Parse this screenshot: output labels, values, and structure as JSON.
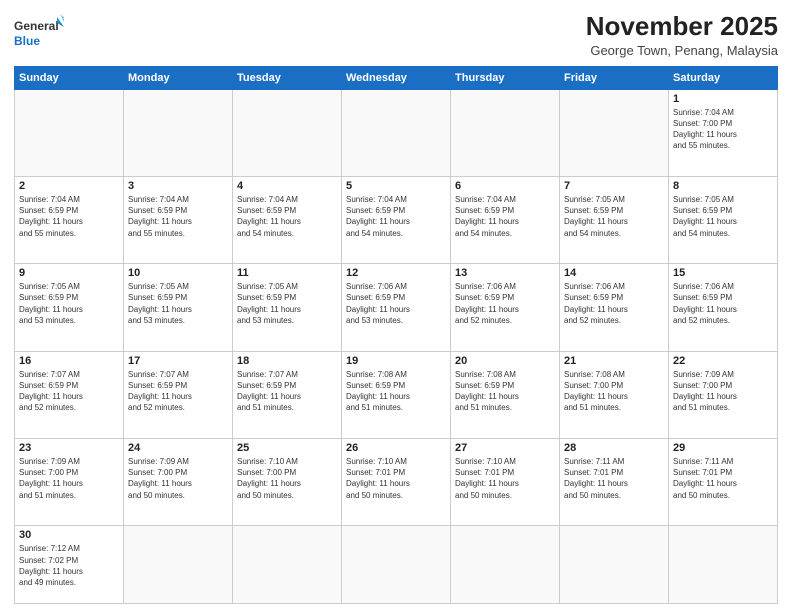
{
  "header": {
    "logo_general": "General",
    "logo_blue": "Blue",
    "month_year": "November 2025",
    "location": "George Town, Penang, Malaysia"
  },
  "days_of_week": [
    "Sunday",
    "Monday",
    "Tuesday",
    "Wednesday",
    "Thursday",
    "Friday",
    "Saturday"
  ],
  "weeks": [
    [
      {
        "day": "",
        "info": ""
      },
      {
        "day": "",
        "info": ""
      },
      {
        "day": "",
        "info": ""
      },
      {
        "day": "",
        "info": ""
      },
      {
        "day": "",
        "info": ""
      },
      {
        "day": "",
        "info": ""
      },
      {
        "day": "1",
        "info": "Sunrise: 7:04 AM\nSunset: 7:00 PM\nDaylight: 11 hours\nand 55 minutes."
      }
    ],
    [
      {
        "day": "2",
        "info": "Sunrise: 7:04 AM\nSunset: 6:59 PM\nDaylight: 11 hours\nand 55 minutes."
      },
      {
        "day": "3",
        "info": "Sunrise: 7:04 AM\nSunset: 6:59 PM\nDaylight: 11 hours\nand 55 minutes."
      },
      {
        "day": "4",
        "info": "Sunrise: 7:04 AM\nSunset: 6:59 PM\nDaylight: 11 hours\nand 54 minutes."
      },
      {
        "day": "5",
        "info": "Sunrise: 7:04 AM\nSunset: 6:59 PM\nDaylight: 11 hours\nand 54 minutes."
      },
      {
        "day": "6",
        "info": "Sunrise: 7:04 AM\nSunset: 6:59 PM\nDaylight: 11 hours\nand 54 minutes."
      },
      {
        "day": "7",
        "info": "Sunrise: 7:05 AM\nSunset: 6:59 PM\nDaylight: 11 hours\nand 54 minutes."
      },
      {
        "day": "8",
        "info": "Sunrise: 7:05 AM\nSunset: 6:59 PM\nDaylight: 11 hours\nand 54 minutes."
      }
    ],
    [
      {
        "day": "9",
        "info": "Sunrise: 7:05 AM\nSunset: 6:59 PM\nDaylight: 11 hours\nand 53 minutes."
      },
      {
        "day": "10",
        "info": "Sunrise: 7:05 AM\nSunset: 6:59 PM\nDaylight: 11 hours\nand 53 minutes."
      },
      {
        "day": "11",
        "info": "Sunrise: 7:05 AM\nSunset: 6:59 PM\nDaylight: 11 hours\nand 53 minutes."
      },
      {
        "day": "12",
        "info": "Sunrise: 7:06 AM\nSunset: 6:59 PM\nDaylight: 11 hours\nand 53 minutes."
      },
      {
        "day": "13",
        "info": "Sunrise: 7:06 AM\nSunset: 6:59 PM\nDaylight: 11 hours\nand 52 minutes."
      },
      {
        "day": "14",
        "info": "Sunrise: 7:06 AM\nSunset: 6:59 PM\nDaylight: 11 hours\nand 52 minutes."
      },
      {
        "day": "15",
        "info": "Sunrise: 7:06 AM\nSunset: 6:59 PM\nDaylight: 11 hours\nand 52 minutes."
      }
    ],
    [
      {
        "day": "16",
        "info": "Sunrise: 7:07 AM\nSunset: 6:59 PM\nDaylight: 11 hours\nand 52 minutes."
      },
      {
        "day": "17",
        "info": "Sunrise: 7:07 AM\nSunset: 6:59 PM\nDaylight: 11 hours\nand 52 minutes."
      },
      {
        "day": "18",
        "info": "Sunrise: 7:07 AM\nSunset: 6:59 PM\nDaylight: 11 hours\nand 51 minutes."
      },
      {
        "day": "19",
        "info": "Sunrise: 7:08 AM\nSunset: 6:59 PM\nDaylight: 11 hours\nand 51 minutes."
      },
      {
        "day": "20",
        "info": "Sunrise: 7:08 AM\nSunset: 6:59 PM\nDaylight: 11 hours\nand 51 minutes."
      },
      {
        "day": "21",
        "info": "Sunrise: 7:08 AM\nSunset: 7:00 PM\nDaylight: 11 hours\nand 51 minutes."
      },
      {
        "day": "22",
        "info": "Sunrise: 7:09 AM\nSunset: 7:00 PM\nDaylight: 11 hours\nand 51 minutes."
      }
    ],
    [
      {
        "day": "23",
        "info": "Sunrise: 7:09 AM\nSunset: 7:00 PM\nDaylight: 11 hours\nand 51 minutes."
      },
      {
        "day": "24",
        "info": "Sunrise: 7:09 AM\nSunset: 7:00 PM\nDaylight: 11 hours\nand 50 minutes."
      },
      {
        "day": "25",
        "info": "Sunrise: 7:10 AM\nSunset: 7:00 PM\nDaylight: 11 hours\nand 50 minutes."
      },
      {
        "day": "26",
        "info": "Sunrise: 7:10 AM\nSunset: 7:01 PM\nDaylight: 11 hours\nand 50 minutes."
      },
      {
        "day": "27",
        "info": "Sunrise: 7:10 AM\nSunset: 7:01 PM\nDaylight: 11 hours\nand 50 minutes."
      },
      {
        "day": "28",
        "info": "Sunrise: 7:11 AM\nSunset: 7:01 PM\nDaylight: 11 hours\nand 50 minutes."
      },
      {
        "day": "29",
        "info": "Sunrise: 7:11 AM\nSunset: 7:01 PM\nDaylight: 11 hours\nand 50 minutes."
      }
    ],
    [
      {
        "day": "30",
        "info": "Sunrise: 7:12 AM\nSunset: 7:02 PM\nDaylight: 11 hours\nand 49 minutes."
      },
      {
        "day": "",
        "info": ""
      },
      {
        "day": "",
        "info": ""
      },
      {
        "day": "",
        "info": ""
      },
      {
        "day": "",
        "info": ""
      },
      {
        "day": "",
        "info": ""
      },
      {
        "day": "",
        "info": ""
      }
    ]
  ]
}
